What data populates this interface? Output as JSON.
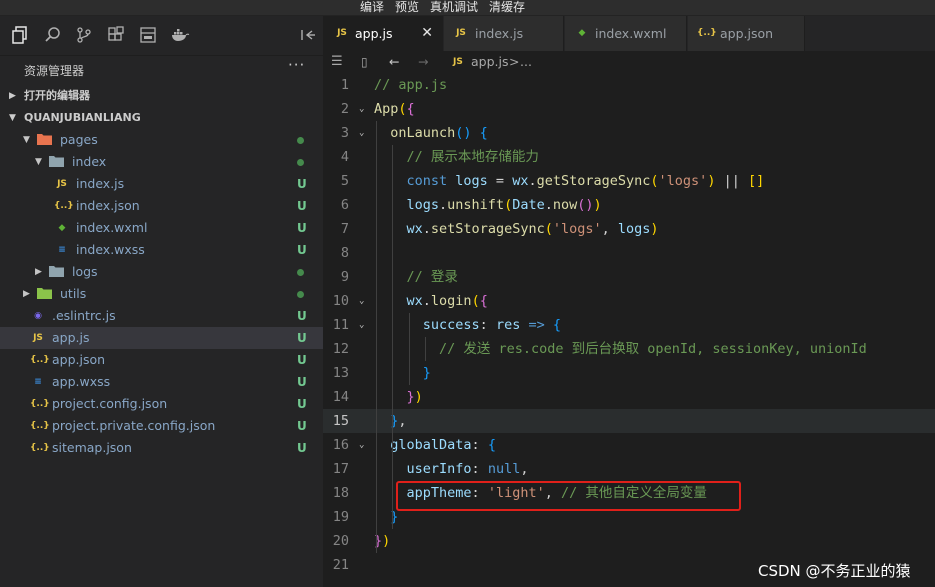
{
  "menu": [
    "编译",
    "预览",
    "真机调试",
    "清缓存"
  ],
  "activity_icons": [
    "explorer-icon",
    "search-icon",
    "source-control-icon",
    "extensions-icon",
    "layout-icon",
    "docker-icon"
  ],
  "explorer": {
    "title": "资源管理器",
    "more": "···",
    "open_editors": "打开的编辑器",
    "project": "QUANJUBIANLIANG",
    "tree": [
      {
        "name": "pages",
        "type": "folder",
        "depth": 1,
        "open": true,
        "status": "dot",
        "icon": "▪",
        "color": "#e8744f"
      },
      {
        "name": "index",
        "type": "folder",
        "depth": 2,
        "open": true,
        "status": "dot",
        "icon": "▪",
        "color": "#90a4ae"
      },
      {
        "name": "index.js",
        "type": "js",
        "depth": 3,
        "status": "U",
        "icon": "JS",
        "color": "#e8c547"
      },
      {
        "name": "index.json",
        "type": "json",
        "depth": 3,
        "status": "U",
        "icon": "{..}",
        "color": "#e8c547"
      },
      {
        "name": "index.wxml",
        "type": "wxml",
        "depth": 3,
        "status": "U",
        "icon": "◆",
        "color": "#5fb336"
      },
      {
        "name": "index.wxss",
        "type": "wxss",
        "depth": 3,
        "status": "U",
        "icon": "≡",
        "color": "#3b8ee0"
      },
      {
        "name": "logs",
        "type": "folder",
        "depth": 2,
        "open": false,
        "status": "dot",
        "icon": "▪",
        "color": "#90a4ae"
      },
      {
        "name": "utils",
        "type": "folder",
        "depth": 1,
        "open": false,
        "status": "dot",
        "icon": "▪",
        "color": "#8bc34a"
      },
      {
        "name": ".eslintrc.js",
        "type": "eslint",
        "depth": 1,
        "status": "U",
        "icon": "◉",
        "color": "#7b68ee"
      },
      {
        "name": "app.js",
        "type": "js",
        "depth": 1,
        "status": "U",
        "icon": "JS",
        "color": "#e8c547",
        "selected": true
      },
      {
        "name": "app.json",
        "type": "json",
        "depth": 1,
        "status": "U",
        "icon": "{..}",
        "color": "#e8c547"
      },
      {
        "name": "app.wxss",
        "type": "wxss",
        "depth": 1,
        "status": "U",
        "icon": "≡",
        "color": "#3b8ee0"
      },
      {
        "name": "project.config.json",
        "type": "json",
        "depth": 1,
        "status": "U",
        "icon": "{..}",
        "color": "#e8c547"
      },
      {
        "name": "project.private.config.json",
        "type": "json",
        "depth": 1,
        "status": "U",
        "icon": "{..}",
        "color": "#e8c547"
      },
      {
        "name": "sitemap.json",
        "type": "json",
        "depth": 1,
        "status": "U",
        "icon": "{..}",
        "color": "#e8c547"
      }
    ]
  },
  "tabs": [
    {
      "label": "app.js",
      "icon": "JS",
      "color": "#e8c547",
      "active": true,
      "close": "✕"
    },
    {
      "label": "index.js",
      "icon": "JS",
      "color": "#e8c547"
    },
    {
      "label": "index.wxml",
      "icon": "◆",
      "color": "#5fb336"
    },
    {
      "label": "app.json",
      "icon": "{..}",
      "color": "#e8c547"
    }
  ],
  "breadcrumb": {
    "file": "app.js",
    "sep": ">",
    "rest": "..."
  },
  "editor": {
    "current_line": 15,
    "lines": [
      {
        "n": "1",
        "t": [
          [
            "// app.js",
            "com"
          ]
        ]
      },
      {
        "n": "2",
        "fold": true,
        "t": [
          [
            "App",
            "fn"
          ],
          [
            "(",
            "b1"
          ],
          [
            "{",
            "b2"
          ]
        ]
      },
      {
        "n": "3",
        "fold": true,
        "t": [
          [
            "  onLaunch",
            "fn"
          ],
          [
            "() ",
            "b3"
          ],
          [
            "{",
            "b3"
          ]
        ]
      },
      {
        "n": "4",
        "t": [
          [
            "    // 展示本地存储能力",
            "com"
          ]
        ]
      },
      {
        "n": "5",
        "t": [
          [
            "    const ",
            "kw"
          ],
          [
            "logs",
            "var"
          ],
          [
            " = ",
            "tx"
          ],
          [
            "wx",
            "var"
          ],
          [
            ".",
            "tx"
          ],
          [
            "getStorageSync",
            "fn"
          ],
          [
            "(",
            "b1"
          ],
          [
            "'logs'",
            "str"
          ],
          [
            ")",
            "b1"
          ],
          [
            " || ",
            "tx"
          ],
          [
            "[]",
            "b1"
          ]
        ]
      },
      {
        "n": "6",
        "t": [
          [
            "    logs",
            "var"
          ],
          [
            ".",
            "tx"
          ],
          [
            "unshift",
            "fn"
          ],
          [
            "(",
            "b1"
          ],
          [
            "Date",
            "var"
          ],
          [
            ".",
            "tx"
          ],
          [
            "now",
            "fn"
          ],
          [
            "()",
            "b2"
          ],
          [
            ")",
            "b1"
          ]
        ]
      },
      {
        "n": "7",
        "t": [
          [
            "    wx",
            "var"
          ],
          [
            ".",
            "tx"
          ],
          [
            "setStorageSync",
            "fn"
          ],
          [
            "(",
            "b1"
          ],
          [
            "'logs'",
            "str"
          ],
          [
            ", ",
            "tx"
          ],
          [
            "logs",
            "var"
          ],
          [
            ")",
            "b1"
          ]
        ]
      },
      {
        "n": "8",
        "t": []
      },
      {
        "n": "9",
        "t": [
          [
            "    // 登录",
            "com"
          ]
        ]
      },
      {
        "n": "10",
        "fold": true,
        "t": [
          [
            "    wx",
            "var"
          ],
          [
            ".",
            "tx"
          ],
          [
            "login",
            "fn"
          ],
          [
            "(",
            "b1"
          ],
          [
            "{",
            "b2"
          ]
        ]
      },
      {
        "n": "11",
        "fold": true,
        "t": [
          [
            "      success",
            "var"
          ],
          [
            ": ",
            "tx"
          ],
          [
            "res",
            "var"
          ],
          [
            " => ",
            "kw"
          ],
          [
            "{",
            "b3"
          ]
        ]
      },
      {
        "n": "12",
        "t": [
          [
            "        // 发送 res.code 到后台换取 openId, sessionKey, unionId",
            "com"
          ]
        ]
      },
      {
        "n": "13",
        "t": [
          [
            "      }",
            "b3"
          ]
        ]
      },
      {
        "n": "14",
        "t": [
          [
            "    }",
            "b2"
          ],
          [
            ")",
            "b1"
          ]
        ]
      },
      {
        "n": "15",
        "t": [
          [
            "  }",
            "b3"
          ],
          [
            ",",
            "tx"
          ]
        ]
      },
      {
        "n": "16",
        "fold": true,
        "t": [
          [
            "  globalData",
            "var"
          ],
          [
            ": ",
            "tx"
          ],
          [
            "{",
            "b3"
          ]
        ]
      },
      {
        "n": "17",
        "t": [
          [
            "    userInfo",
            "var"
          ],
          [
            ": ",
            "tx"
          ],
          [
            "null",
            "kw"
          ],
          [
            ",",
            "tx"
          ]
        ]
      },
      {
        "n": "18",
        "t": [
          [
            "    appTheme",
            "var"
          ],
          [
            ": ",
            "tx"
          ],
          [
            "'light'",
            "str"
          ],
          [
            ", ",
            "tx"
          ],
          [
            "// 其他自定义全局变量",
            "com"
          ]
        ]
      },
      {
        "n": "19",
        "t": [
          [
            "  }",
            "b3"
          ]
        ]
      },
      {
        "n": "20",
        "t": [
          [
            "}",
            "b2"
          ],
          [
            ")",
            "b1"
          ]
        ]
      },
      {
        "n": "21",
        "t": []
      }
    ]
  },
  "watermark": "CSDN @不务正业的猿"
}
